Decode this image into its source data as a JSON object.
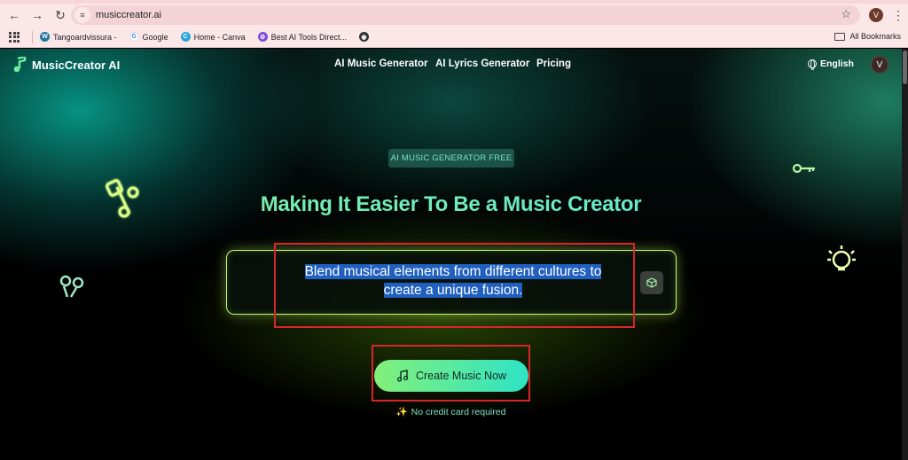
{
  "browser": {
    "url": "musiccreator.ai",
    "profile_initial": "V",
    "bookmarks": [
      {
        "label": "Tangoardvissura -",
        "icon": "wordpress-icon"
      },
      {
        "label": "Google",
        "icon": "google-icon"
      },
      {
        "label": "Home - Canva",
        "icon": "canva-icon"
      },
      {
        "label": "Best AI Tools Direct...",
        "icon": "ai-tools-icon"
      },
      {
        "label": "",
        "icon": "globe-icon"
      }
    ],
    "all_bookmarks": "All Bookmarks"
  },
  "site": {
    "logo_text": "MusicCreator AI",
    "nav": [
      "AI Music Generator",
      "AI Lyrics Generator",
      "Pricing"
    ],
    "language": "English",
    "avatar_initial": "V"
  },
  "hero": {
    "badge": "AI MUSIC GENERATOR FREE",
    "headline": "Making It Easier To Be a Music Creator",
    "prompt_line1": "Blend musical elements from different cultures to",
    "prompt_line2": "create a unique fusion.",
    "cta_label": "Create Music Now",
    "no_credit": "No credit card required"
  },
  "colors": {
    "accent_green": "#83f07a",
    "accent_teal": "#2ee3c6",
    "highlight": "#1f5fbf",
    "annotation_red": "#d8252a"
  }
}
